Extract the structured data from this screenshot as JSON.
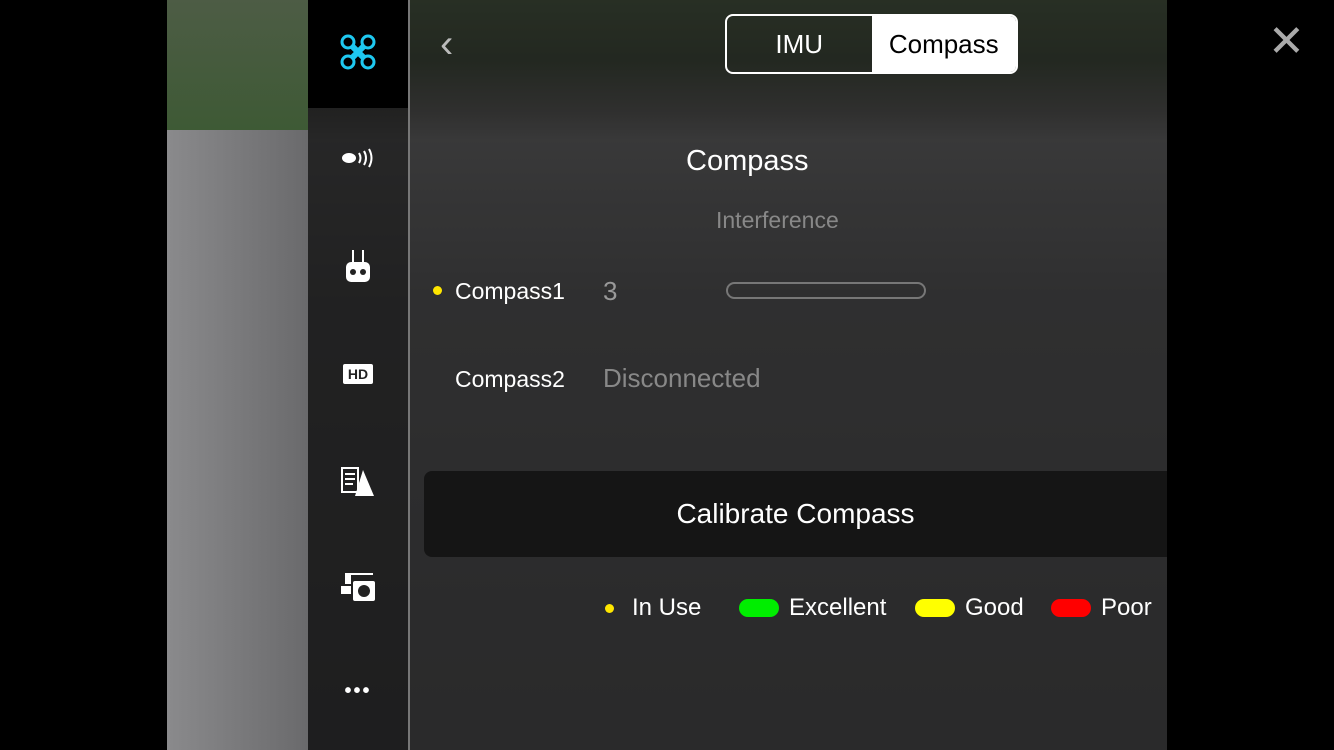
{
  "nav": {
    "items": [
      {
        "icon": "aircraft-icon",
        "active": true
      },
      {
        "icon": "signal-icon"
      },
      {
        "icon": "remote-controller-icon"
      },
      {
        "icon": "hd-icon",
        "label": "HD"
      },
      {
        "icon": "checklist-navigation-icon"
      },
      {
        "icon": "gimbal-camera-icon"
      },
      {
        "icon": "more-icon"
      }
    ]
  },
  "tabs": [
    {
      "label": "IMU",
      "active": false
    },
    {
      "label": "Compass",
      "active": true
    }
  ],
  "title": "Compass",
  "interference_label": "Interference",
  "compasses": [
    {
      "name": "Compass1",
      "value": "3",
      "in_use": true,
      "interference_fill": 0
    },
    {
      "name": "Compass2",
      "value": "Disconnected",
      "in_use": false
    }
  ],
  "calibrate_label": "Calibrate Compass",
  "legend": [
    {
      "label": "In Use",
      "color": "#ffe600"
    },
    {
      "label": "Excellent",
      "color": "#00ee00"
    },
    {
      "label": "Good",
      "color": "#ffff00"
    },
    {
      "label": "Poor",
      "color": "#ff0000"
    }
  ]
}
